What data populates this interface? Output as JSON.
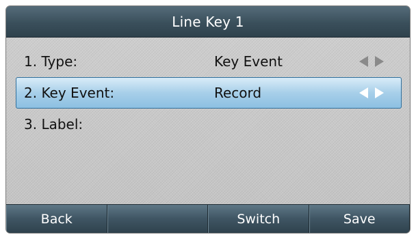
{
  "title": "Line Key 1",
  "rows": [
    {
      "label": "1. Type:",
      "value": "Key Event",
      "has_arrows": true,
      "selected": false
    },
    {
      "label": "2. Key Event:",
      "value": "Record",
      "has_arrows": true,
      "selected": true
    },
    {
      "label": "3. Label:",
      "value": "",
      "has_arrows": false,
      "selected": false
    }
  ],
  "softkeys": [
    "Back",
    "",
    "Switch",
    "Save"
  ],
  "colors": {
    "title_bar": "#3a4f5b",
    "selection": "#a7cfe9",
    "background": "#c9c9c9",
    "arrow_inactive": "#8a8a8a",
    "arrow_active": "#ffffff"
  },
  "icons": {
    "left_arrow": "triangle-left-icon",
    "right_arrow": "triangle-right-icon"
  }
}
